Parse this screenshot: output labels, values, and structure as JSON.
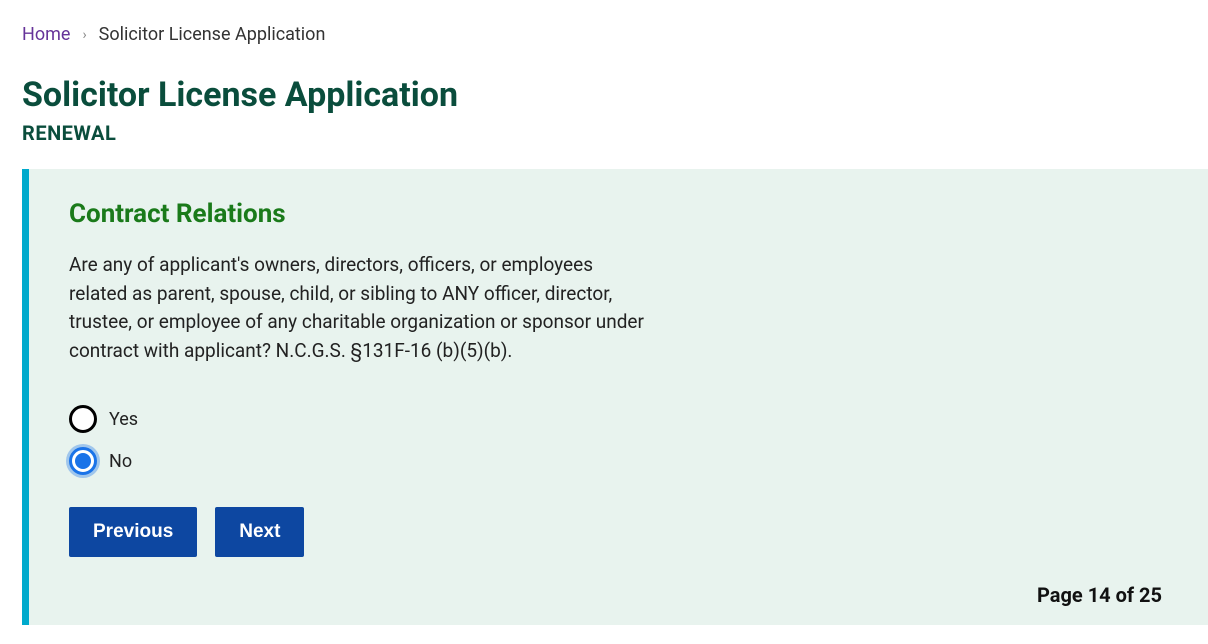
{
  "breadcrumb": {
    "home": "Home",
    "current": "Solicitor License Application"
  },
  "header": {
    "title": "Solicitor License Application",
    "subtitle": "RENEWAL"
  },
  "panel": {
    "section_title": "Contract Relations",
    "question": "Are any of applicant's owners, directors, officers, or employees related as parent, spouse, child, or sibling to ANY officer, director, trustee, or employee of any charitable organization or sponsor under contract with applicant? N.C.G.S. §131F-16 (b)(5)(b).",
    "options": {
      "yes": "Yes",
      "no": "No"
    },
    "selected": "no",
    "buttons": {
      "previous": "Previous",
      "next": "Next"
    },
    "page_indicator": "Page 14 of 25"
  }
}
